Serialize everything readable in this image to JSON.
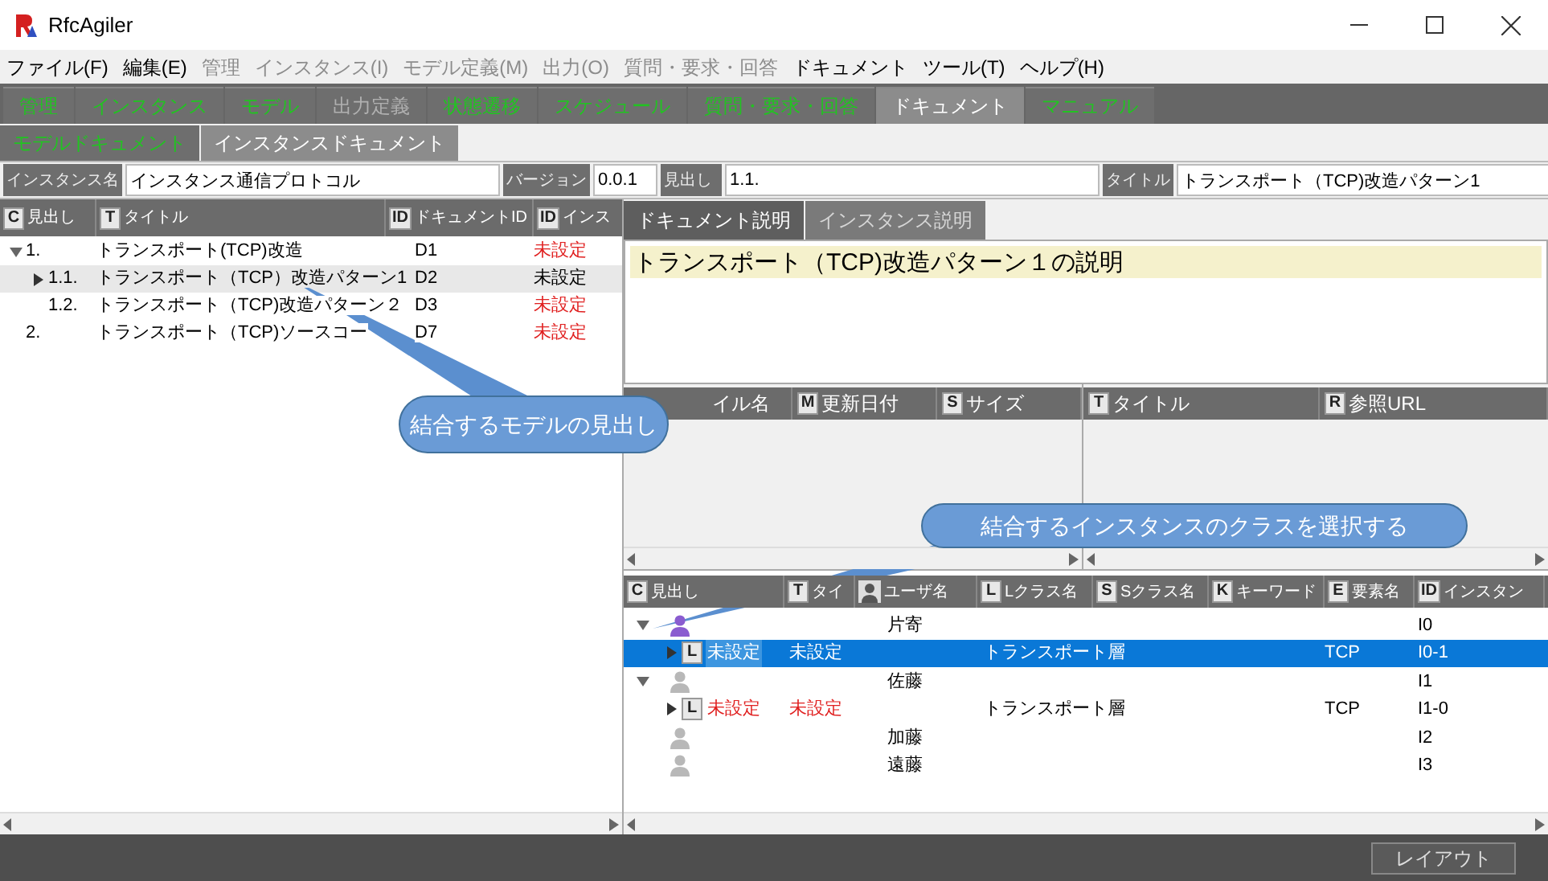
{
  "window": {
    "title": "RfcAgiler"
  },
  "menu": [
    {
      "label": "ファイル(F)",
      "disabled": false
    },
    {
      "label": "編集(E)",
      "disabled": false
    },
    {
      "label": "管理",
      "disabled": true
    },
    {
      "label": "インスタンス(I)",
      "disabled": true
    },
    {
      "label": "モデル定義(M)",
      "disabled": true
    },
    {
      "label": "出力(O)",
      "disabled": true
    },
    {
      "label": "質問・要求・回答",
      "disabled": true
    },
    {
      "label": "ドキュメント",
      "disabled": false
    },
    {
      "label": "ツール(T)",
      "disabled": false
    },
    {
      "label": "ヘルプ(H)",
      "disabled": false
    }
  ],
  "main_tabs": [
    {
      "label": "管理",
      "selected": false,
      "disabled": false
    },
    {
      "label": "インスタンス",
      "selected": false,
      "disabled": false
    },
    {
      "label": "モデル",
      "selected": false,
      "disabled": false
    },
    {
      "label": "出力定義",
      "selected": false,
      "disabled": true
    },
    {
      "label": "状態遷移",
      "selected": false,
      "disabled": false
    },
    {
      "label": "スケジュール",
      "selected": false,
      "disabled": false
    },
    {
      "label": "質問・要求・回答",
      "selected": false,
      "disabled": false
    },
    {
      "label": "ドキュメント",
      "selected": true,
      "disabled": false
    },
    {
      "label": "マニュアル",
      "selected": false,
      "disabled": false
    }
  ],
  "sub_tabs": [
    {
      "label": "モデルドキュメント",
      "selected": false
    },
    {
      "label": "インスタンスドキュメント",
      "selected": true
    }
  ],
  "fields": [
    {
      "label": "インスタンス名",
      "value": "インスタンス通信プロトコル"
    },
    {
      "label": "バージョン",
      "value": "0.0.1"
    },
    {
      "label": "見出し",
      "value": "1.1."
    },
    {
      "label": "タイトル",
      "value": "トランスポート（TCP)改造パターン1"
    }
  ],
  "doc_tree": {
    "columns": [
      {
        "icon": "C",
        "label": "見出し"
      },
      {
        "icon": "T",
        "label": "タイトル"
      },
      {
        "icon": "ID",
        "label": "ドキュメントID"
      },
      {
        "icon": "ID",
        "label": "インス"
      }
    ],
    "rows": [
      {
        "heading": "1.",
        "title": "トランスポート(TCP)改造",
        "doc_id": "D1",
        "status": "未設定",
        "color": "#e02020",
        "selected": false,
        "expanded": true,
        "children": [
          {
            "heading": "1.1.",
            "title": "トランスポート（TCP）改造パターン1",
            "doc_id": "D2",
            "status": "未設定",
            "color": "#000000",
            "selected": true,
            "expanded": false
          },
          {
            "heading": "1.2.",
            "title": "トランスポート（TCP)改造パターン２",
            "doc_id": "D3",
            "status": "未設定",
            "color": "#e02020",
            "selected": false
          }
        ]
      },
      {
        "heading": "2.",
        "title": "トランスポート（TCP)ソースコー",
        "doc_id": "D7",
        "status": "未設定",
        "color": "#e02020",
        "selected": false
      }
    ]
  },
  "doc_tabs": [
    {
      "label": "ドキュメント説明",
      "selected": true
    },
    {
      "label": "インスタンス説明",
      "selected": false
    }
  ],
  "description": {
    "text": "トランスポート（TCP)改造パターン１の説明",
    "highlighted": true
  },
  "files_table": {
    "columns": [
      {
        "label": "イル名"
      },
      {
        "icon": "M",
        "label": "更新日付"
      },
      {
        "icon": "S",
        "label": "サイズ"
      }
    ]
  },
  "links_table": {
    "columns": [
      {
        "icon": "T",
        "label": "タイトル"
      },
      {
        "icon": "R",
        "label": "参照URL"
      }
    ]
  },
  "instance_tree": {
    "columns": [
      {
        "icon": "C",
        "label": "見出し"
      },
      {
        "icon": "T",
        "label": "タイ"
      },
      {
        "label": "ユーザ名"
      },
      {
        "icon": "L",
        "label": "Lクラス名"
      },
      {
        "icon": "S",
        "label": "Sクラス名"
      },
      {
        "icon": "K",
        "label": "キーワード"
      },
      {
        "icon": "E",
        "label": "要素名"
      },
      {
        "icon": "ID",
        "label": "インスタン"
      }
    ],
    "rows": [
      {
        "kind": "user",
        "name": "片寄",
        "id": "I0",
        "active": true,
        "expanded": true,
        "children": [
          {
            "kind": "class",
            "icon": "L",
            "heading": "未設定",
            "title": "未設定",
            "lclass": "トランスポート層",
            "element": "TCP",
            "id": "I0-1",
            "selected": true,
            "expanded": false
          }
        ]
      },
      {
        "kind": "user",
        "name": "佐藤",
        "id": "I1",
        "active": false,
        "expanded": true,
        "children": [
          {
            "kind": "class",
            "icon": "L",
            "heading": "未設定",
            "title": "未設定",
            "lclass": "トランスポート層",
            "element": "TCP",
            "id": "I1-0",
            "selected": false,
            "color": "#e02020",
            "expanded": false
          }
        ]
      },
      {
        "kind": "user",
        "name": "加藤",
        "id": "I2",
        "active": false
      },
      {
        "kind": "user",
        "name": "遠藤",
        "id": "I3",
        "active": false
      }
    ]
  },
  "status_bar": {
    "button": "レイアウト"
  },
  "callouts": [
    {
      "text": "結合するモデルの見出し"
    },
    {
      "text": "結合するインスタンスのクラスを選択する"
    }
  ]
}
